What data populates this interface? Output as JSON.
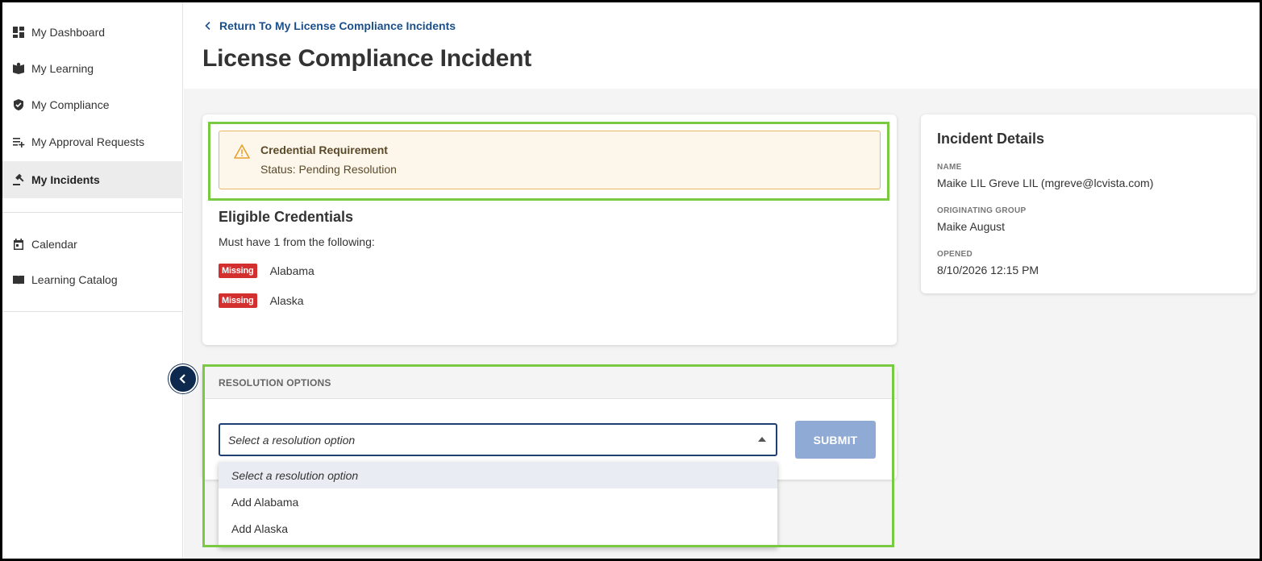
{
  "sidebar": {
    "items": [
      {
        "label": "My Dashboard",
        "icon": "dashboard-icon"
      },
      {
        "label": "My Learning",
        "icon": "learning-icon"
      },
      {
        "label": "My Compliance",
        "icon": "shield-check-icon"
      },
      {
        "label": "My Approval Requests",
        "icon": "playlist-add-icon"
      },
      {
        "label": "My Incidents",
        "icon": "gavel-icon",
        "active": true
      },
      {
        "label": "Calendar",
        "icon": "calendar-icon"
      },
      {
        "label": "Learning Catalog",
        "icon": "book-icon"
      }
    ]
  },
  "header": {
    "back_link": "Return To My License Compliance Incidents",
    "title": "License Compliance Incident"
  },
  "alert": {
    "title": "Credential Requirement",
    "status": "Status: Pending Resolution",
    "icon": "warning-icon"
  },
  "eligible": {
    "title": "Eligible Credentials",
    "subtitle": "Must have 1 from the following:",
    "credentials": [
      {
        "badge": "Missing",
        "name": "Alabama"
      },
      {
        "badge": "Missing",
        "name": "Alaska"
      }
    ]
  },
  "resolution": {
    "title": "RESOLUTION OPTIONS",
    "select_value": "Select a resolution option",
    "submit_label": "SUBMIT",
    "options": [
      "Select a resolution option",
      "Add Alabama",
      "Add Alaska"
    ]
  },
  "details": {
    "title": "Incident Details",
    "name_label": "NAME",
    "name_value": "Maike LIL Greve LIL (mgreve@lcvista.com)",
    "group_label": "ORIGINATING GROUP",
    "group_value": "Maike August",
    "opened_label": "OPENED",
    "opened_value": "8/10/2026 12:15 PM"
  },
  "colors": {
    "accent": "#1a4f8b",
    "missing_badge": "#d32f2f",
    "highlight": "#7ac943",
    "submit_disabled": "#8faad4"
  }
}
